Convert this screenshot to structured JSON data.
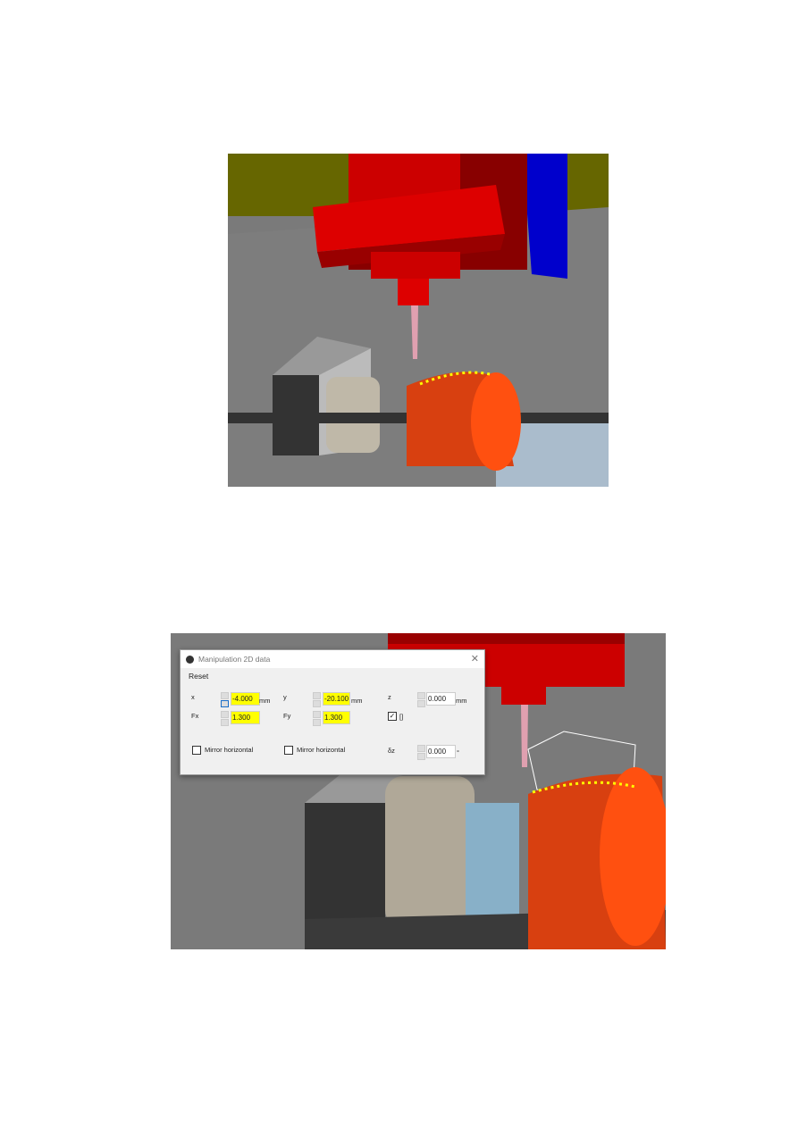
{
  "dialog": {
    "title": "Manipulation 2D data",
    "close": "✕",
    "reset": "Reset",
    "x_label": "x",
    "x_value": "-4.000",
    "x_unit": "mm",
    "y_label": "y",
    "y_value": "-20.100",
    "y_unit": "mm",
    "z_label": "z",
    "z_value": "0.000",
    "z_unit": "mm",
    "fx_label": "Fx",
    "fx_value": "1.300",
    "fy_label": "Fy",
    "fy_value": "1.300",
    "lock_label": "[]",
    "lock_checked": true,
    "mirror1": "Mirror horizontal",
    "mirror2": "Mirror horizontal",
    "rot_label": "δz",
    "rot_value": "0.000",
    "rot_unit": "°"
  },
  "colors": {
    "highlight": "#ffff00",
    "spindle": "#cc0000",
    "workpiece": "#d84010"
  }
}
